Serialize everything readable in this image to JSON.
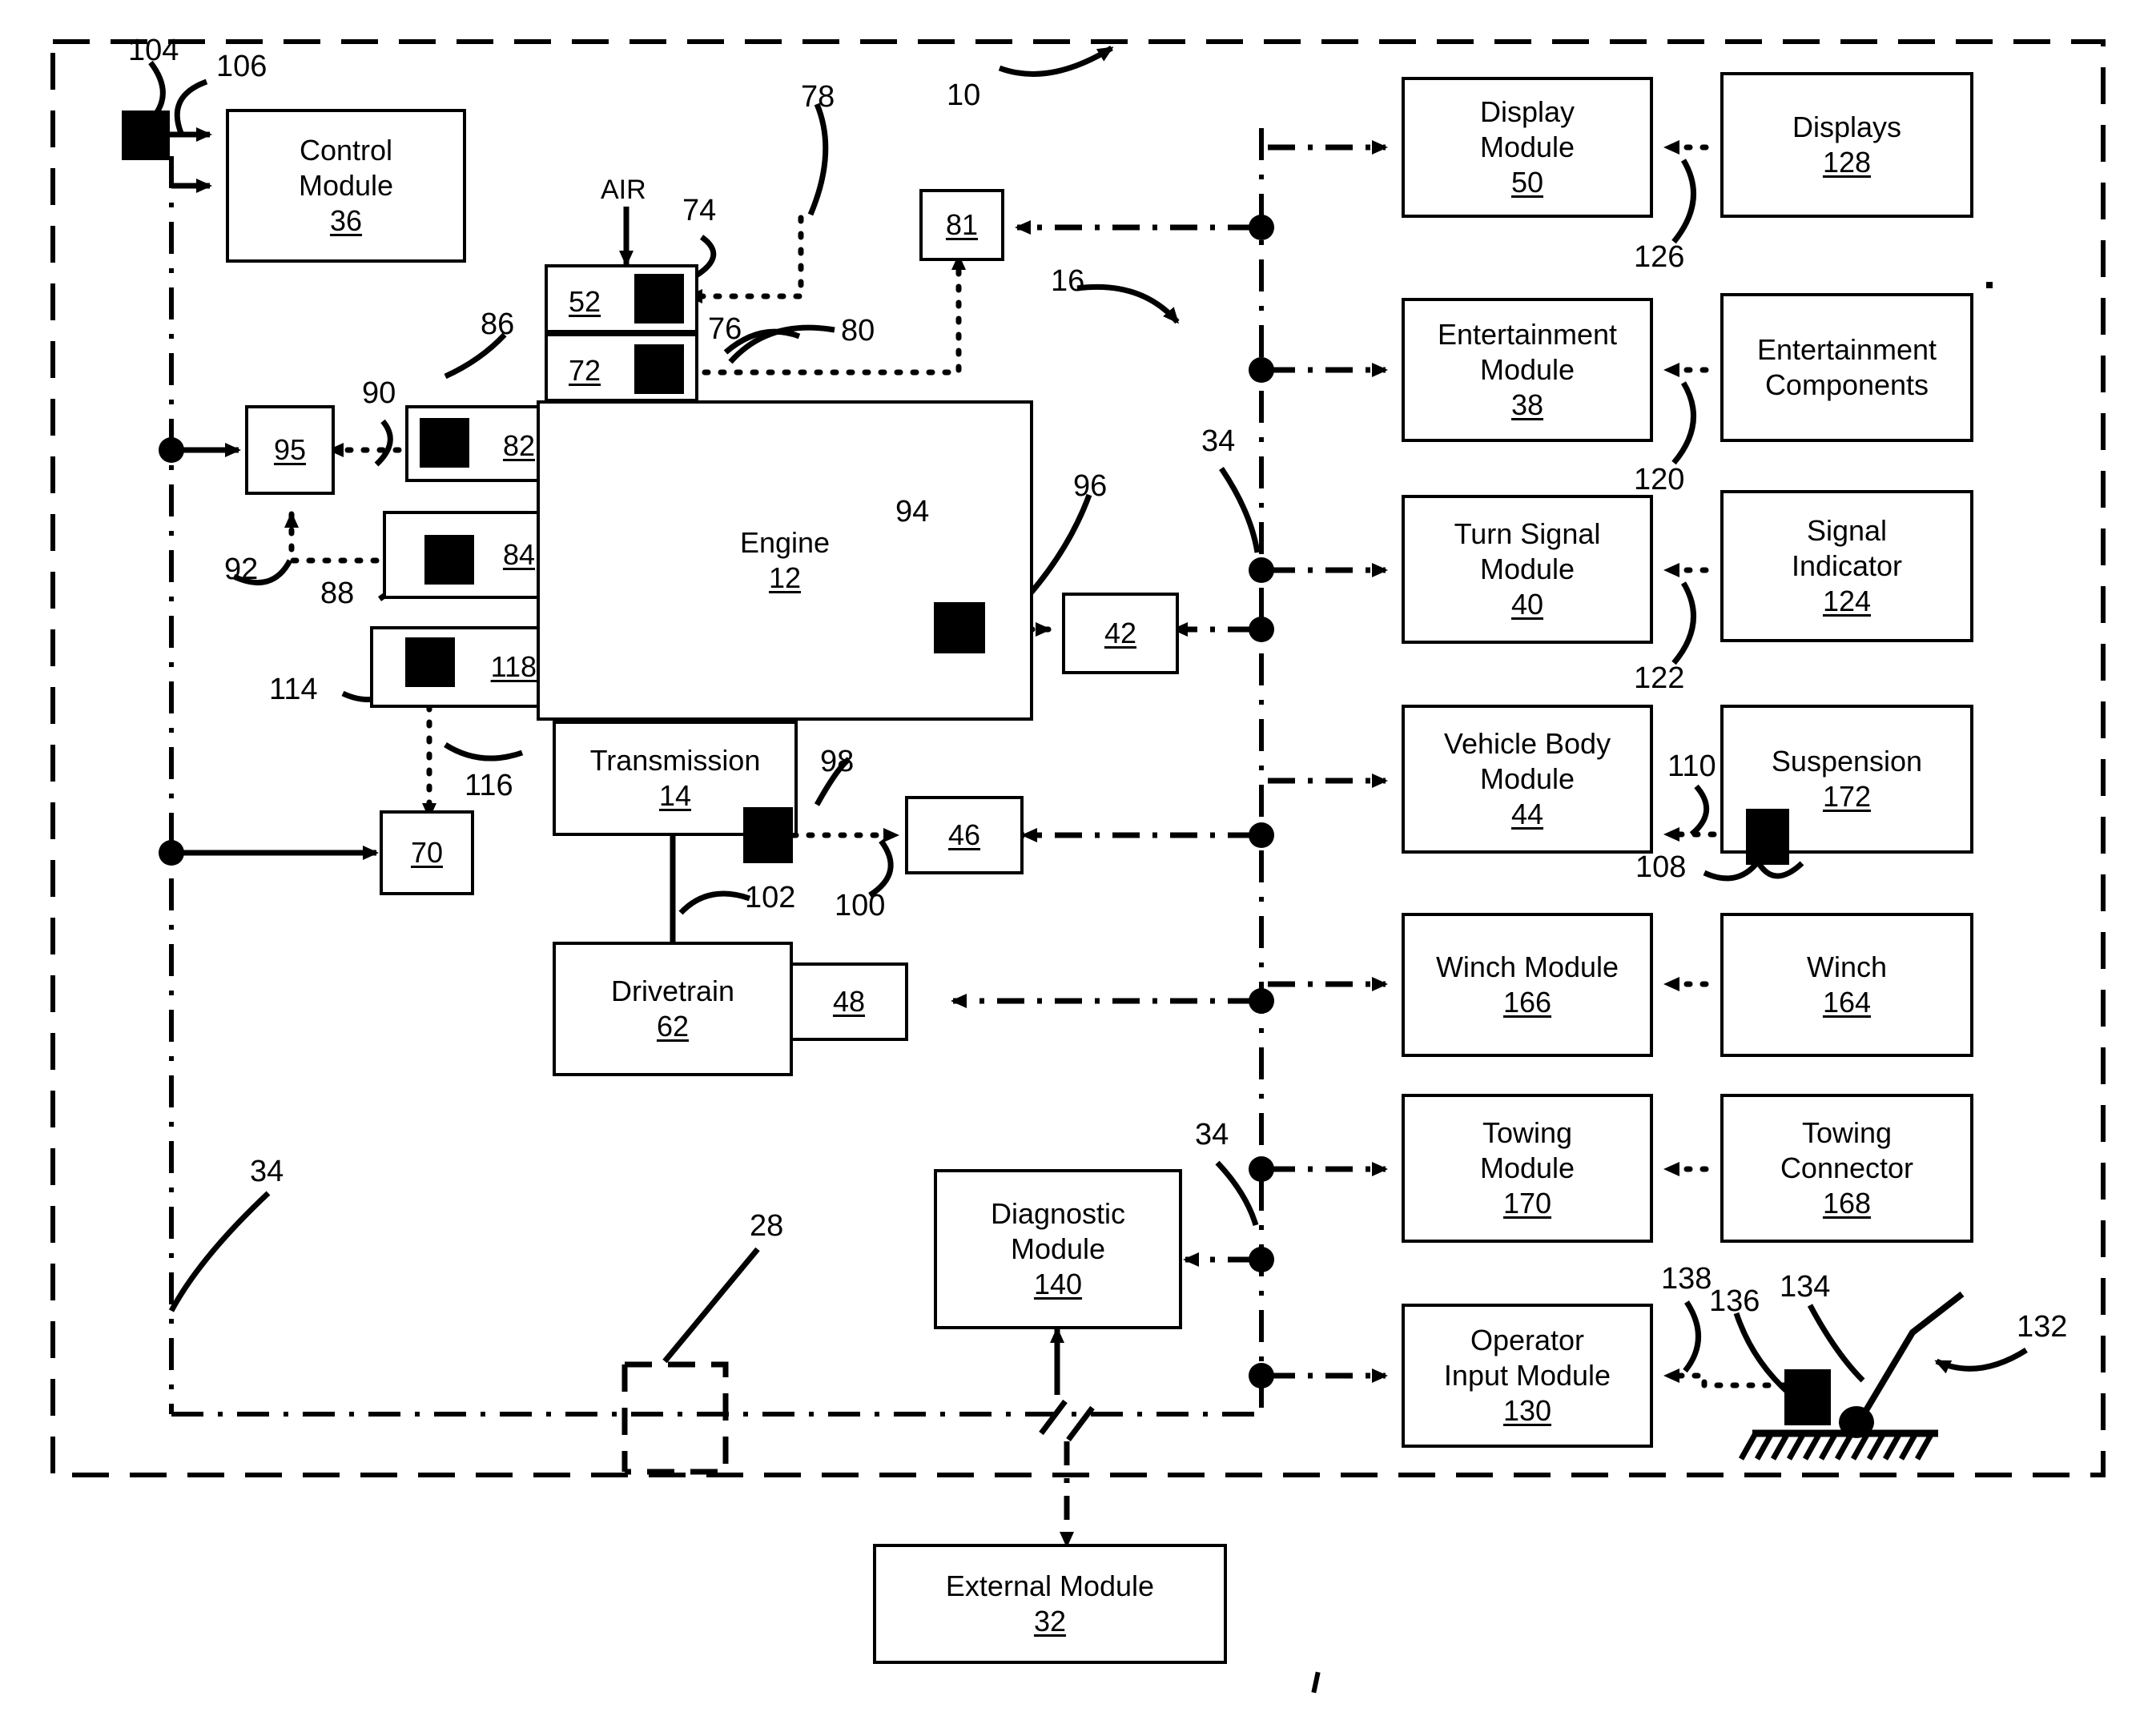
{
  "figure": {
    "domain": "patent-block-diagram",
    "air_label": "AIR"
  },
  "boxes": [
    {
      "key": "control_module",
      "title": "Control\nModule",
      "num": "36"
    },
    {
      "key": "engine",
      "title": "Engine",
      "num": "12"
    },
    {
      "key": "transmission",
      "title": "Transmission",
      "num": "14"
    },
    {
      "key": "drivetrain",
      "title": "Drivetrain",
      "num": "62"
    },
    {
      "key": "diagnostic_module",
      "title": "Diagnostic\nModule",
      "num": "140"
    },
    {
      "key": "external_module",
      "title": "External Module",
      "num": "32"
    },
    {
      "key": "display_module",
      "title": "Display\nModule",
      "num": "50"
    },
    {
      "key": "displays",
      "title": "Displays",
      "num": "128"
    },
    {
      "key": "entertainment_module",
      "title": "Entertainment\nModule",
      "num": "38"
    },
    {
      "key": "entertainment_components",
      "title": "Entertainment\nComponents",
      "num": ""
    },
    {
      "key": "turn_signal_module",
      "title": "Turn Signal\nModule",
      "num": "40"
    },
    {
      "key": "signal_indicator",
      "title": "Signal\nIndicator",
      "num": "124"
    },
    {
      "key": "vehicle_body_module",
      "title": "Vehicle Body\nModule",
      "num": "44"
    },
    {
      "key": "suspension",
      "title": "Suspension",
      "num": "172"
    },
    {
      "key": "winch_module",
      "title": "Winch Module",
      "num": "166"
    },
    {
      "key": "winch",
      "title": "Winch",
      "num": "164"
    },
    {
      "key": "towing_module",
      "title": "Towing\nModule",
      "num": "170"
    },
    {
      "key": "towing_connector",
      "title": "Towing\nConnector",
      "num": "168"
    },
    {
      "key": "operator_input_module",
      "title": "Operator\nInput Module",
      "num": "130"
    }
  ],
  "number_boxes": [
    {
      "key": "box81",
      "num": "81"
    },
    {
      "key": "box95",
      "num": "95"
    },
    {
      "key": "box42",
      "num": "42"
    },
    {
      "key": "box46",
      "num": "46"
    },
    {
      "key": "box48",
      "num": "48"
    },
    {
      "key": "box52",
      "num": "52"
    },
    {
      "key": "box72",
      "num": "72"
    },
    {
      "key": "box70",
      "num": "70"
    },
    {
      "key": "box82",
      "num": "82"
    },
    {
      "key": "box84",
      "num": "84"
    },
    {
      "key": "box118",
      "num": "118"
    }
  ],
  "reference_numerals": [
    {
      "key": "ref104",
      "text": "104"
    },
    {
      "key": "ref106",
      "text": "106"
    },
    {
      "key": "ref78",
      "text": "78"
    },
    {
      "key": "ref10",
      "text": "10"
    },
    {
      "key": "ref74",
      "text": "74"
    },
    {
      "key": "ref76",
      "text": "76"
    },
    {
      "key": "ref80",
      "text": "80"
    },
    {
      "key": "ref16",
      "text": "16"
    },
    {
      "key": "ref86",
      "text": "86"
    },
    {
      "key": "ref90",
      "text": "90"
    },
    {
      "key": "ref92",
      "text": "92"
    },
    {
      "key": "ref88",
      "text": "88"
    },
    {
      "key": "ref114",
      "text": "114"
    },
    {
      "key": "ref116",
      "text": "116"
    },
    {
      "key": "ref94",
      "text": "94"
    },
    {
      "key": "ref96",
      "text": "96"
    },
    {
      "key": "ref98",
      "text": "98"
    },
    {
      "key": "ref100",
      "text": "100"
    },
    {
      "key": "ref102",
      "text": "102"
    },
    {
      "key": "ref34_bus_top",
      "text": "34"
    },
    {
      "key": "ref34_bus_mid",
      "text": "34"
    },
    {
      "key": "ref34_left",
      "text": "34"
    },
    {
      "key": "ref28",
      "text": "28"
    },
    {
      "key": "ref126",
      "text": "126"
    },
    {
      "key": "ref120",
      "text": "120"
    },
    {
      "key": "ref122",
      "text": "122"
    },
    {
      "key": "ref110",
      "text": "110"
    },
    {
      "key": "ref108",
      "text": "108"
    },
    {
      "key": "ref138",
      "text": "138"
    },
    {
      "key": "ref136",
      "text": "136"
    },
    {
      "key": "ref134",
      "text": "134"
    },
    {
      "key": "ref132",
      "text": "132"
    }
  ],
  "colors": {
    "line": "#000000",
    "background": "#ffffff"
  }
}
